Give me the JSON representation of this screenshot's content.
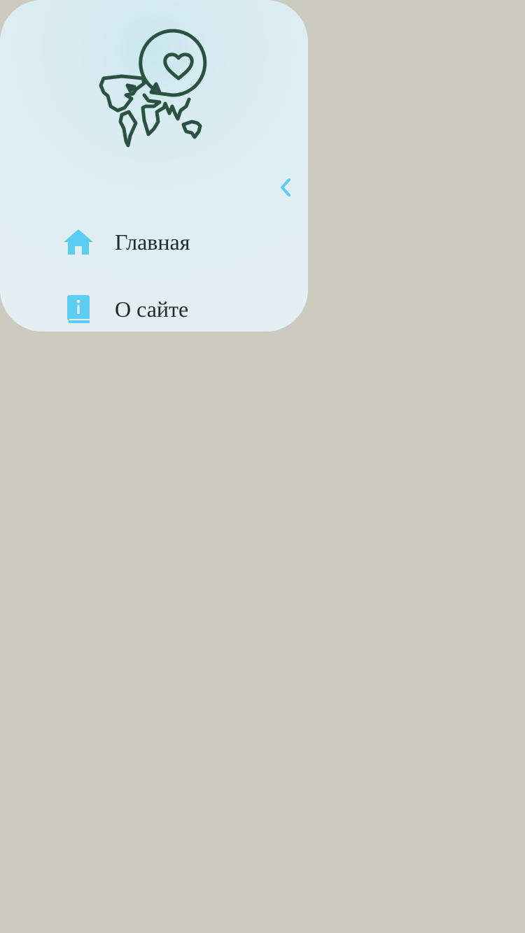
{
  "colors": {
    "page_background": "#cacabe",
    "drawer_background": "#e2eef2",
    "accent": "#5bcdf0",
    "logo_stroke": "#2b5240",
    "text": "#1f2a2a"
  },
  "drawer": {
    "logo_icon": "world-map-heart-icon",
    "collapse_icon": "chevron-left-icon",
    "nav": {
      "items": [
        {
          "label": "Главная",
          "icon": "home-icon"
        },
        {
          "label": "О сайте",
          "icon": "info-book-icon"
        }
      ]
    }
  }
}
